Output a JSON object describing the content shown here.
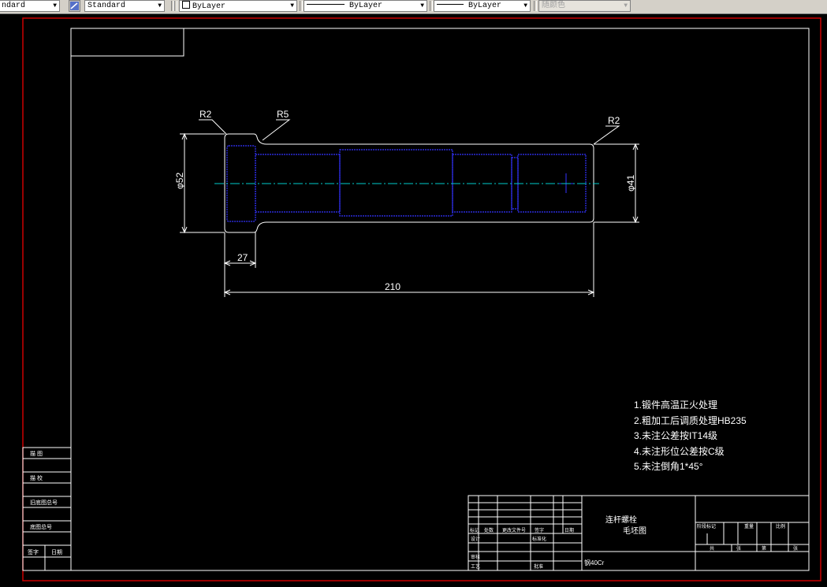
{
  "toolbar": {
    "text_style": "ndard",
    "dim_style": "Standard",
    "layer": "ByLayer",
    "linetype": "ByLayer",
    "lineweight": "ByLayer",
    "color": "随颜色"
  },
  "drawing": {
    "dims": {
      "r2_left": "R2",
      "r5": "R5",
      "r2_right": "R2",
      "dia_52": "φ52",
      "dia_41": "φ41",
      "len_27": "27",
      "len_210": "210"
    },
    "notes": [
      "1.锻件高温正火处理",
      "2.粗加工后调质处理HB235",
      "3.未注公差按IT14级",
      "4.未注形位公差按C级",
      "5.未注倒角1*45°"
    ],
    "title_block": {
      "part_name": "连杆螺栓",
      "drawing_type": "毛坯图",
      "material": "钢40Cr",
      "cells": [
        "标记",
        "处数",
        "更改文件号",
        "签字",
        "日期",
        "设计",
        "标准化",
        "审核",
        "工艺",
        "阶段标记",
        "重量",
        "比例",
        "共",
        "张",
        "第",
        "张",
        "批准"
      ]
    },
    "side_block": [
      "描 图",
      "描 校",
      "旧底图总号",
      "底图总号",
      "签字",
      "日期"
    ]
  },
  "colors": {
    "background": "#000000",
    "frame_red": "#cc0000",
    "lines": "#ffffff",
    "hidden_blue": "#3333ff",
    "center_cyan": "#00cccc"
  }
}
